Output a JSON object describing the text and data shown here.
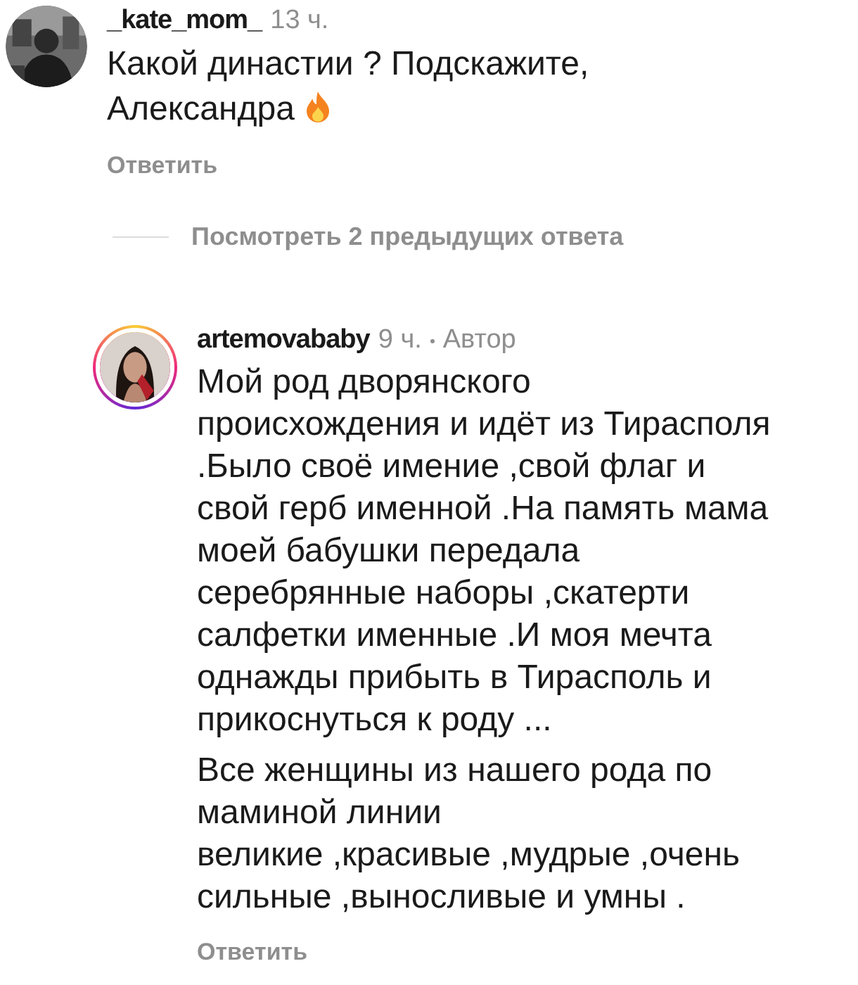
{
  "comments": [
    {
      "username": "_kate_mom_",
      "time": "13 ч.",
      "avatar": {
        "kind": "picture"
      },
      "story_ring": false,
      "paragraphs": [
        "Какой династии ? Подскажите,\nАлександра"
      ],
      "flame_emoji": true,
      "reply": "Ответить"
    },
    {
      "username": "artemovababy",
      "time": "9 ч.",
      "author_label": "Автор",
      "avatar": {
        "kind": "picture"
      },
      "story_ring": true,
      "paragraphs": [
        "Мой род дворянского\nпроисхождения и идёт из Тирасполя\n.Было своё имение ,свой флаг и\nсвой герб именной .На память мама\nмоей бабушки передала\nсеребрянные наборы ,скатерти\nсалфетки именные .И моя мечта\nоднажды прибыть в Тирасполь и\nприкоснуться к роду ...",
        "Все женщины из нашего рода по\nмаминой линии\nвеликие ,красивые ,мудрые ,очень\nсильные ,выносливые и умны ."
      ],
      "reply": "Ответить"
    }
  ],
  "view_replies": "Посмотреть 2 предыдущих ответа"
}
